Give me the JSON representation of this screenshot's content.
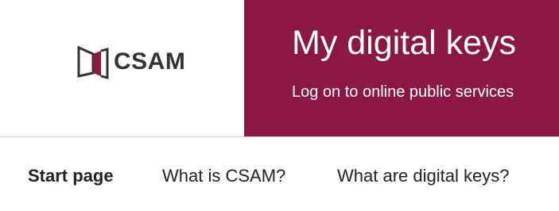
{
  "header": {
    "logo": {
      "icon": "csam-logo-icon",
      "text": "CSAM",
      "accent_color": "#8a1842"
    },
    "hero": {
      "title": "My digital keys",
      "subtitle": "Log on to online public services",
      "background_color": "#8a1842"
    }
  },
  "nav": {
    "items": [
      {
        "label": "Start page",
        "active": true
      },
      {
        "label": "What is CSAM?",
        "active": false
      },
      {
        "label": "What are digital keys?",
        "active": false
      }
    ]
  }
}
